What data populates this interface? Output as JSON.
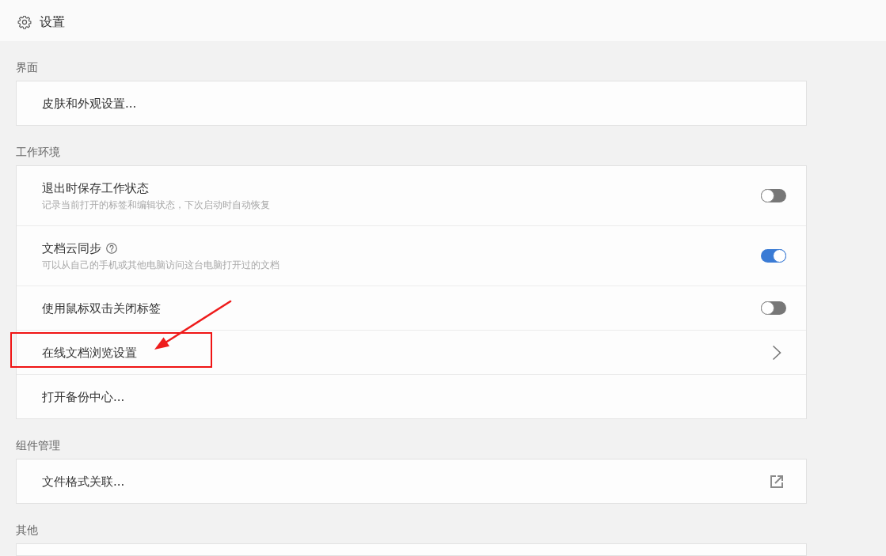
{
  "window": {
    "title": "设置"
  },
  "sections": [
    {
      "title": "界面",
      "items": [
        {
          "kind": "link",
          "label": "皮肤和外观设置...",
          "help": false,
          "highlighted": false
        }
      ]
    },
    {
      "title": "工作环境",
      "items": [
        {
          "kind": "toggle",
          "label": "退出时保存工作状态",
          "description": "记录当前打开的标签和编辑状态，下次启动时自动恢复",
          "on": false,
          "help": false,
          "highlighted": false
        },
        {
          "kind": "toggle",
          "label": "文档云同步",
          "description": "可以从自己的手机或其他电脑访问这台电脑打开过的文档",
          "on": true,
          "help": true,
          "highlighted": false
        },
        {
          "kind": "toggle",
          "label": "使用鼠标双击关闭标签",
          "on": false,
          "help": false,
          "highlighted": false
        },
        {
          "kind": "submenu",
          "label": "在线文档浏览设置",
          "help": false,
          "highlighted": true
        },
        {
          "kind": "link",
          "label": "打开备份中心...",
          "help": false,
          "highlighted": false
        }
      ]
    },
    {
      "title": "组件管理",
      "items": [
        {
          "kind": "external",
          "label": "文件格式关联...",
          "help": false,
          "highlighted": false
        }
      ]
    },
    {
      "title": "其他"
    }
  ]
}
